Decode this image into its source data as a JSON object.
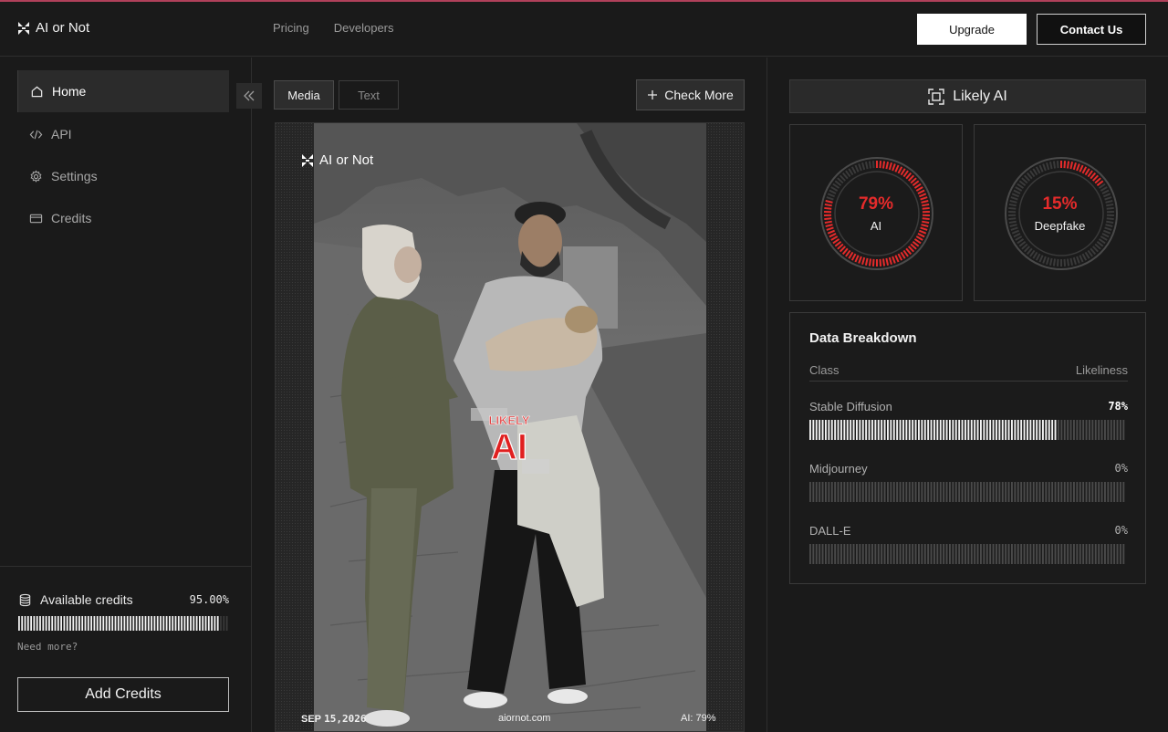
{
  "header": {
    "brand": "AI or Not",
    "nav": [
      "Pricing",
      "Developers"
    ],
    "upgrade_label": "Upgrade",
    "contact_label": "Contact Us"
  },
  "sidebar": {
    "items": [
      {
        "label": "Home",
        "icon": "home-icon",
        "active": true
      },
      {
        "label": "API",
        "icon": "code-icon",
        "active": false
      },
      {
        "label": "Settings",
        "icon": "gear-icon",
        "active": false
      },
      {
        "label": "Credits",
        "icon": "card-icon",
        "active": false
      }
    ],
    "credits_label": "Available credits",
    "credits_value": "95.00%",
    "credits_fraction": 0.95,
    "need_more": "Need more?",
    "add_credits_label": "Add Credits"
  },
  "center": {
    "tabs": [
      {
        "label": "Media",
        "active": true
      },
      {
        "label": "Text",
        "active": false
      }
    ],
    "check_more_label": "Check More",
    "photo": {
      "overlay_brand": "AI or Not",
      "stamp_top": "LIKELY",
      "stamp_main": "AI",
      "date_prefix": "SEP",
      "date_rest": "15,2026",
      "site": "aiornot.com",
      "ai_score": "AI: 79%"
    }
  },
  "results": {
    "verdict": "Likely AI",
    "accent_color": "#e52b2b",
    "gauges": [
      {
        "percent": "79%",
        "label": "AI",
        "fraction": 0.79
      },
      {
        "percent": "15%",
        "label": "Deepfake",
        "fraction": 0.15
      }
    ],
    "breakdown": {
      "title": "Data Breakdown",
      "col_class": "Class",
      "col_likeliness": "Likeliness",
      "rows": [
        {
          "name": "Stable Diffusion",
          "value": "78%",
          "fraction": 0.78
        },
        {
          "name": "Midjourney",
          "value": "0%",
          "fraction": 0
        },
        {
          "name": "DALL-E",
          "value": "0%",
          "fraction": 0
        }
      ]
    }
  }
}
